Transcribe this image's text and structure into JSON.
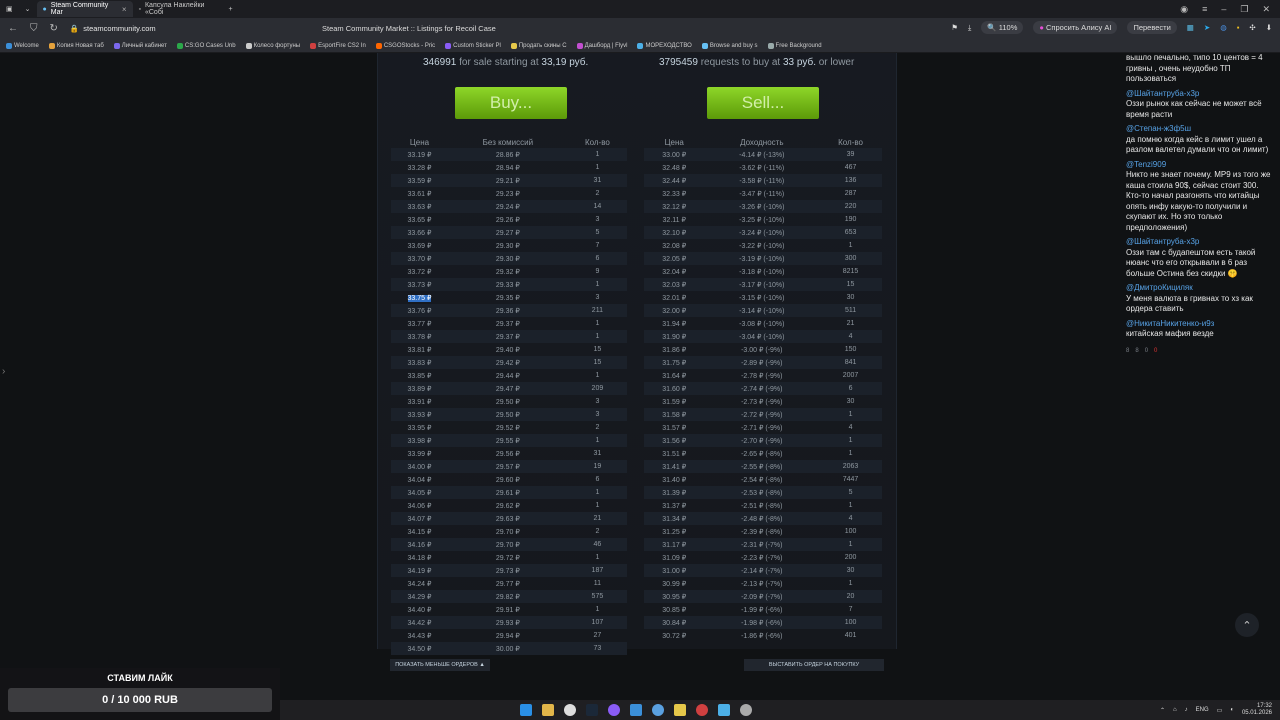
{
  "browser": {
    "tabs": [
      {
        "label": "Steam Community Mar",
        "active": true
      },
      {
        "label": "Капсула Наклейки «Собі",
        "active": false
      }
    ],
    "url": "steamcommunity.com",
    "page_title": "Steam Community Market :: Listings for Recoil Case",
    "zoom": "110%",
    "ask_alice": "Спросить Алису AI",
    "translate": "Перевести",
    "bookmarks": [
      "Welcome",
      "Копия Новая таб",
      "Личный кабинет",
      "CS:GO Cases Unb",
      "Колесо фортуны",
      "EsportFire CS2 In",
      "CSGOStocks - Pric",
      "Custom Sticker Pl",
      "Продать скины С",
      "Дашборд | Flyvl",
      "МОРЕХОДСТВО",
      "Browse and buy s",
      "Free Background"
    ]
  },
  "market": {
    "sell_count": "346991",
    "sell_text": "for sale starting at",
    "sell_price": "33,19 руб.",
    "buy_count": "3795459",
    "buy_text": "requests to buy at",
    "buy_price": "33 руб.",
    "buy_suffix": "or lower",
    "buy_button": "Buy...",
    "sell_button": "Sell...",
    "sell_headers": [
      "Цена",
      "Без комиссий",
      "Кол-во"
    ],
    "buy_headers": [
      "Цена",
      "Доходность",
      "Кол-во"
    ],
    "sell_orders": [
      [
        "33.19 ₽",
        "28.86 ₽",
        "1"
      ],
      [
        "33.28 ₽",
        "28.94 ₽",
        "1"
      ],
      [
        "33.59 ₽",
        "29.21 ₽",
        "31"
      ],
      [
        "33.61 ₽",
        "29.23 ₽",
        "2"
      ],
      [
        "33.63 ₽",
        "29.24 ₽",
        "14"
      ],
      [
        "33.65 ₽",
        "29.26 ₽",
        "3"
      ],
      [
        "33.66 ₽",
        "29.27 ₽",
        "5"
      ],
      [
        "33.69 ₽",
        "29.30 ₽",
        "7"
      ],
      [
        "33.70 ₽",
        "29.30 ₽",
        "6"
      ],
      [
        "33.72 ₽",
        "29.32 ₽",
        "9"
      ],
      [
        "33.73 ₽",
        "29.33 ₽",
        "1"
      ],
      [
        "33.75 ₽",
        "29.35 ₽",
        "3"
      ],
      [
        "33.76 ₽",
        "29.36 ₽",
        "211"
      ],
      [
        "33.77 ₽",
        "29.37 ₽",
        "1"
      ],
      [
        "33.78 ₽",
        "29.37 ₽",
        "1"
      ],
      [
        "33.81 ₽",
        "29.40 ₽",
        "15"
      ],
      [
        "33.83 ₽",
        "29.42 ₽",
        "15"
      ],
      [
        "33.85 ₽",
        "29.44 ₽",
        "1"
      ],
      [
        "33.89 ₽",
        "29.47 ₽",
        "209"
      ],
      [
        "33.91 ₽",
        "29.50 ₽",
        "3"
      ],
      [
        "33.93 ₽",
        "29.50 ₽",
        "3"
      ],
      [
        "33.95 ₽",
        "29.52 ₽",
        "2"
      ],
      [
        "33.98 ₽",
        "29.55 ₽",
        "1"
      ],
      [
        "33.99 ₽",
        "29.56 ₽",
        "31"
      ],
      [
        "34.00 ₽",
        "29.57 ₽",
        "19"
      ],
      [
        "34.04 ₽",
        "29.60 ₽",
        "6"
      ],
      [
        "34.05 ₽",
        "29.61 ₽",
        "1"
      ],
      [
        "34.06 ₽",
        "29.62 ₽",
        "1"
      ],
      [
        "34.07 ₽",
        "29.63 ₽",
        "21"
      ],
      [
        "34.15 ₽",
        "29.70 ₽",
        "2"
      ],
      [
        "34.16 ₽",
        "29.70 ₽",
        "46"
      ],
      [
        "34.18 ₽",
        "29.72 ₽",
        "1"
      ],
      [
        "34.19 ₽",
        "29.73 ₽",
        "187"
      ],
      [
        "34.24 ₽",
        "29.77 ₽",
        "11"
      ],
      [
        "34.29 ₽",
        "29.82 ₽",
        "575"
      ],
      [
        "34.40 ₽",
        "29.91 ₽",
        "1"
      ],
      [
        "34.42 ₽",
        "29.93 ₽",
        "107"
      ],
      [
        "34.43 ₽",
        "29.94 ₽",
        "27"
      ],
      [
        "34.50 ₽",
        "30.00 ₽",
        "73"
      ]
    ],
    "buy_orders": [
      [
        "33.00 ₽",
        "-4.14 ₽ (-13%)",
        "39"
      ],
      [
        "32.48 ₽",
        "-3.62 ₽ (-11%)",
        "467"
      ],
      [
        "32.44 ₽",
        "-3.58 ₽ (-11%)",
        "136"
      ],
      [
        "32.33 ₽",
        "-3.47 ₽ (-11%)",
        "287"
      ],
      [
        "32.12 ₽",
        "-3.26 ₽ (-10%)",
        "220"
      ],
      [
        "32.11 ₽",
        "-3.25 ₽ (-10%)",
        "190"
      ],
      [
        "32.10 ₽",
        "-3.24 ₽ (-10%)",
        "653"
      ],
      [
        "32.08 ₽",
        "-3.22 ₽ (-10%)",
        "1"
      ],
      [
        "32.05 ₽",
        "-3.19 ₽ (-10%)",
        "300"
      ],
      [
        "32.04 ₽",
        "-3.18 ₽ (-10%)",
        "8215"
      ],
      [
        "32.03 ₽",
        "-3.17 ₽ (-10%)",
        "15"
      ],
      [
        "32.01 ₽",
        "-3.15 ₽ (-10%)",
        "30"
      ],
      [
        "32.00 ₽",
        "-3.14 ₽ (-10%)",
        "511"
      ],
      [
        "31.94 ₽",
        "-3.08 ₽ (-10%)",
        "21"
      ],
      [
        "31.90 ₽",
        "-3.04 ₽ (-10%)",
        "4"
      ],
      [
        "31.86 ₽",
        "-3.00 ₽ (-9%)",
        "150"
      ],
      [
        "31.75 ₽",
        "-2.89 ₽ (-9%)",
        "841"
      ],
      [
        "31.64 ₽",
        "-2.78 ₽ (-9%)",
        "2007"
      ],
      [
        "31.60 ₽",
        "-2.74 ₽ (-9%)",
        "6"
      ],
      [
        "31.59 ₽",
        "-2.73 ₽ (-9%)",
        "30"
      ],
      [
        "31.58 ₽",
        "-2.72 ₽ (-9%)",
        "1"
      ],
      [
        "31.57 ₽",
        "-2.71 ₽ (-9%)",
        "4"
      ],
      [
        "31.56 ₽",
        "-2.70 ₽ (-9%)",
        "1"
      ],
      [
        "31.51 ₽",
        "-2.65 ₽ (-8%)",
        "1"
      ],
      [
        "31.41 ₽",
        "-2.55 ₽ (-8%)",
        "2063"
      ],
      [
        "31.40 ₽",
        "-2.54 ₽ (-8%)",
        "7447"
      ],
      [
        "31.39 ₽",
        "-2.53 ₽ (-8%)",
        "5"
      ],
      [
        "31.37 ₽",
        "-2.51 ₽ (-8%)",
        "1"
      ],
      [
        "31.34 ₽",
        "-2.48 ₽ (-8%)",
        "4"
      ],
      [
        "31.25 ₽",
        "-2.39 ₽ (-8%)",
        "100"
      ],
      [
        "31.17 ₽",
        "-2.31 ₽ (-7%)",
        "1"
      ],
      [
        "31.09 ₽",
        "-2.23 ₽ (-7%)",
        "200"
      ],
      [
        "31.00 ₽",
        "-2.14 ₽ (-7%)",
        "30"
      ],
      [
        "30.99 ₽",
        "-2.13 ₽ (-7%)",
        "1"
      ],
      [
        "30.95 ₽",
        "-2.09 ₽ (-7%)",
        "20"
      ],
      [
        "30.85 ₽",
        "-1.99 ₽ (-6%)",
        "7"
      ],
      [
        "30.84 ₽",
        "-1.98 ₽ (-6%)",
        "100"
      ],
      [
        "30.72 ₽",
        "-1.86 ₽ (-6%)",
        "401"
      ]
    ],
    "highlighted_sell_row": 11,
    "show_less": "ПОКАЗАТЬ МЕНЬШЕ ОРДЕРОВ ▲",
    "place_order": "ВЫСТАВИТЬ ОРДЕР НА ПОКУПКУ"
  },
  "chat": {
    "first_text": "вышло печально, типо 10 центов = 4 гривны , очень неудобно ТП пользоваться",
    "messages": [
      {
        "user": "@Шайтантруба-х3р",
        "text": "Оззи рынок как сейчас не может всё время расти"
      },
      {
        "user": "@Степан-ж3ф5ш",
        "text": "да помню когда кейс в лимит ушел а разлом валетел думали что он лимит)"
      },
      {
        "user": "@Tenzi909",
        "text": "Никто не знает почему. МР9 из того же каша стоила 90$, сейчас стоит 300. Кто-то начал разгонять что китайцы опять инфу какую-то получили и скупают их. Но это только предположения)"
      },
      {
        "user": "@Шайтантруба-х3р",
        "text": "Оззи там с будапештом есть такой нюанс что его открывали в 6 раз больше Остина без скидки 🤫"
      },
      {
        "user": "@ДмитроКициляк",
        "text": "У меня валюта в гривнах то хз как ордера ставить"
      },
      {
        "user": "@НикитаНикитенко-и9з",
        "text": "китайская мафия везде"
      }
    ],
    "meta": [
      "8",
      "8",
      "0",
      "0"
    ]
  },
  "donation": {
    "title": "СТАВИМ ЛАЙК",
    "progress_text": "0 / 10 000 RUB",
    "progress_fraction": 0
  },
  "taskbar": {
    "lang": "ENG",
    "time": "17:32",
    "date": "05.01.2026"
  }
}
